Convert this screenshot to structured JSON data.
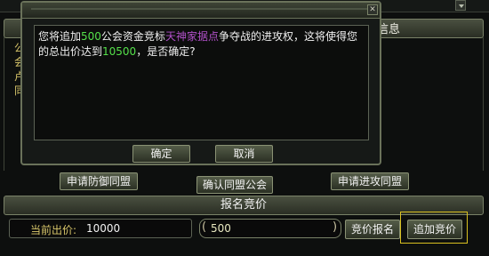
{
  "background": {
    "header_label": "信息",
    "left_chars": "公会卢同",
    "buttons": {
      "apply_defense": "申请防御同盟",
      "confirm_alliance": "确认同盟公会",
      "apply_attack": "申请进攻同盟"
    }
  },
  "bidding": {
    "section_title": "报名竞价",
    "current_bid_label": "当前出价:",
    "current_bid_value": "10000",
    "bid_input_value": "500",
    "bid_signup_label": "竞价报名",
    "add_bid_label": "追加竞价"
  },
  "dialog": {
    "text_1": "您将追加",
    "amount": "500",
    "text_2": "公会资金竞标",
    "location": "天神家据点",
    "text_3": "争夺战的进攻权，这将使得您的总出价达到",
    "total": "10500",
    "text_4": "，是否确定?",
    "ok_label": "确定",
    "cancel_label": "取消"
  },
  "colors": {
    "highlight_green": "#55e04a",
    "highlight_purple": "#b050c8",
    "selection_border": "#d8c020"
  }
}
